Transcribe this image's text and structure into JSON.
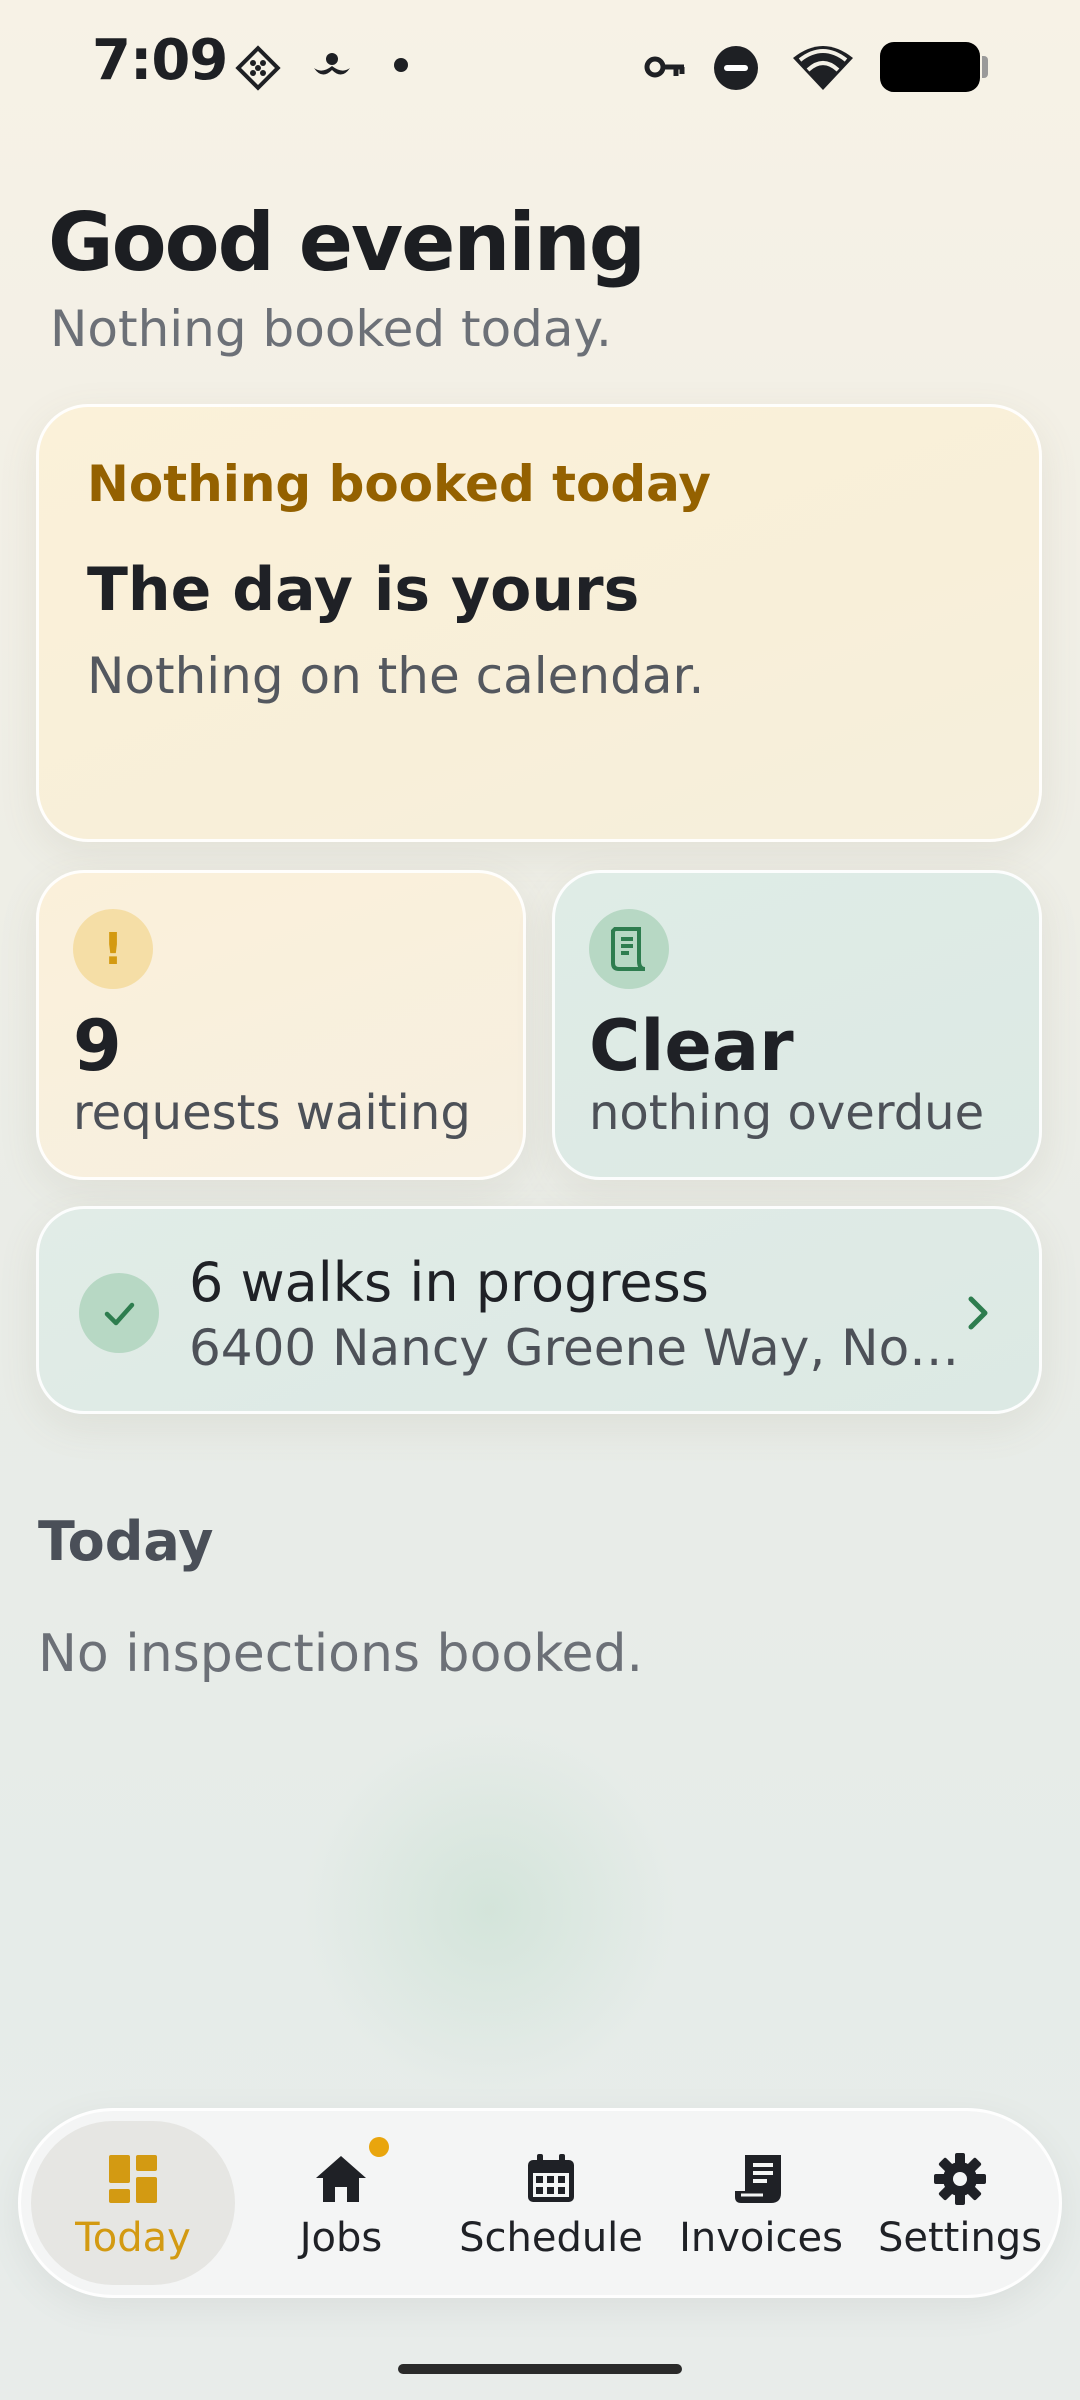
{
  "status_bar": {
    "time": "7:09"
  },
  "header": {
    "greeting": "Good evening",
    "subtitle": "Nothing booked today."
  },
  "hero_card": {
    "label": "Nothing booked today",
    "title": "The day is yours",
    "body": "Nothing on the calendar."
  },
  "stats": {
    "requests": {
      "value": "9",
      "label": "requests waiting",
      "icon": "exclamation-icon"
    },
    "invoices": {
      "value": "Clear",
      "label": "nothing overdue",
      "icon": "receipt-icon"
    }
  },
  "walks": {
    "title": "6 walks in progress",
    "address": "6400 Nancy Greene Way, Nor..."
  },
  "today_section": {
    "title": "Today",
    "empty": "No inspections booked."
  },
  "nav": {
    "items": [
      {
        "label": "Today",
        "icon": "dashboard-icon",
        "active": true
      },
      {
        "label": "Jobs",
        "icon": "home-icon",
        "badge": true
      },
      {
        "label": "Schedule",
        "icon": "calendar-icon"
      },
      {
        "label": "Invoices",
        "icon": "receipt-icon"
      },
      {
        "label": "Settings",
        "icon": "gear-icon"
      }
    ]
  },
  "colors": {
    "accent": "#d39a12",
    "hero_label": "#946100",
    "green": "#2e7d4f",
    "badge_dot": "#e9a50d"
  }
}
